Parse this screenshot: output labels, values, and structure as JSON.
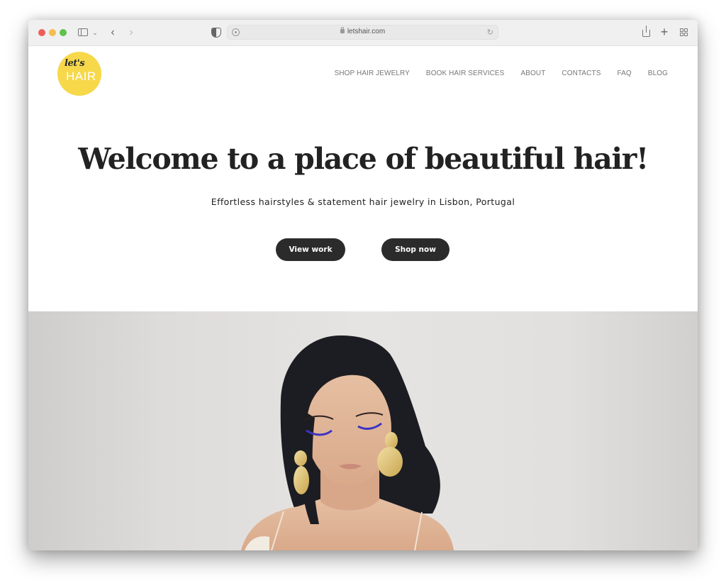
{
  "browser": {
    "url": "letshair.com",
    "traffic_lights": {
      "close": "#ec5f57",
      "minimize": "#f3be4f",
      "zoom": "#5cc34b"
    },
    "icons": {
      "sidebar": "sidebar-icon",
      "tab_menu": "chevron-down-icon",
      "back": "chevron-left-icon",
      "forward": "chevron-right-icon",
      "privacy": "shield-icon",
      "extension": "extension-icon",
      "lock": "lock-icon",
      "reload": "reload-icon",
      "share": "share-icon",
      "new_tab": "plus-icon",
      "tab_overview": "tab-grid-icon"
    },
    "glyphs": {
      "tab_menu": "⌄",
      "back": "‹",
      "forward": "›",
      "reload": "↻",
      "new_tab": "+"
    }
  },
  "site": {
    "logo": {
      "top_text": "let's",
      "bottom_text": "HAIR",
      "color": "#f6d84a"
    },
    "nav": [
      {
        "label": "SHOP HAIR JEWELRY"
      },
      {
        "label": "BOOK HAIR SERVICES"
      },
      {
        "label": "ABOUT"
      },
      {
        "label": "CONTACTS"
      },
      {
        "label": "FAQ"
      },
      {
        "label": "BLOG"
      }
    ],
    "hero": {
      "title": "Welcome to a place of beautiful hair!",
      "subtitle": "Effortless hairstyles & statement hair jewelry in Lisbon, Portugal",
      "buttons": [
        {
          "label": "View work"
        },
        {
          "label": "Shop now"
        }
      ],
      "image_alt": "Woman with dark sleek hair, blue eyeliner and gold statement earrings"
    },
    "colors": {
      "button_bg": "#2b2b2b",
      "text": "#222222",
      "nav_text": "#777777"
    }
  }
}
